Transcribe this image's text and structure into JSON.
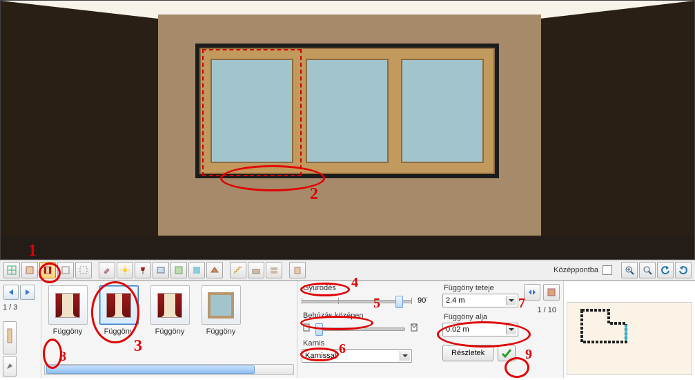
{
  "toolbar": {
    "center_label": "Középpontba",
    "icons": [
      "grid-icon",
      "single-wall-icon",
      "wall-curtain-icon",
      "room-icon",
      "room-outline-icon",
      "paint-icon",
      "sun-icon",
      "lamp-icon",
      "picture-icon",
      "material-icon",
      "sky-icon",
      "roof-icon",
      "stairs-icon",
      "floor1-icon",
      "floor2-icon",
      "building-icon"
    ],
    "right_icons": [
      "zoom-in-icon",
      "zoom-fit-icon",
      "undo-icon",
      "redo-icon"
    ]
  },
  "left_nav": {
    "page": "1 / 3"
  },
  "catalog": {
    "items": [
      {
        "label": "Függöny"
      },
      {
        "label": "Függöny"
      },
      {
        "label": "Függöny"
      },
      {
        "label": "Függöny"
      }
    ]
  },
  "params": {
    "gather_label": "Gyurodés",
    "gather_ticks": 4,
    "gather_value_pos": 140,
    "gather_right": "90˙",
    "center_pull_label": "Behúzás középen",
    "karnis_label": "Karnis",
    "karnis_value": "Karnissal",
    "top_label": "Függöny teteje",
    "top_value": "2.4 m",
    "bottom_label": "Függöny alja",
    "bottom_value": "0.02 m",
    "details_btn": "Részletek"
  },
  "right_nav": {
    "page": "1 / 10"
  },
  "annotations": {
    "n1": "1",
    "n2": "2",
    "n3": "3",
    "n4": "4",
    "n5": "5",
    "n6": "6",
    "n7": "7",
    "n8": "8",
    "n9": "9"
  }
}
